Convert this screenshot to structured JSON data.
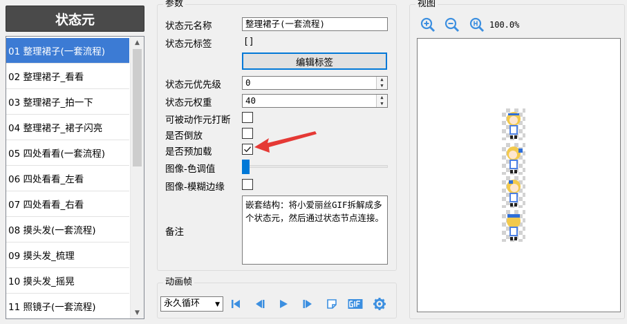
{
  "left_panel": {
    "title": "状态元",
    "items": [
      {
        "label": "01 整理裙子(一套流程)",
        "selected": true
      },
      {
        "label": "02 整理裙子_看看"
      },
      {
        "label": "03 整理裙子_拍一下"
      },
      {
        "label": "04 整理裙子_裙子闪亮"
      },
      {
        "label": "05 四处看看(一套流程)"
      },
      {
        "label": "06 四处看看_左看"
      },
      {
        "label": "07 四处看看_右看"
      },
      {
        "label": "08 摸头发(一套流程)"
      },
      {
        "label": "09 摸头发_梳理"
      },
      {
        "label": "10 摸头发_摇晃"
      },
      {
        "label": "11 照镜子(一套流程)"
      }
    ]
  },
  "params": {
    "group_title": "参数",
    "name_label": "状态元名称",
    "name_value": "整理裙子(一套流程)",
    "tag_label": "状态元标签",
    "tag_value": "[]",
    "edit_tag_button": "编辑标签",
    "priority_label": "状态元优先级",
    "priority_value": "0",
    "weight_label": "状态元权重",
    "weight_value": "40",
    "interruptible_label": "可被动作元打断",
    "interruptible_checked": false,
    "reverse_label": "是否倒放",
    "reverse_checked": false,
    "preload_label": "是否预加载",
    "preload_checked": true,
    "hue_label": "图像-色调值",
    "hue_value": 0,
    "blur_label": "图像-模糊边缘",
    "blur_checked": false,
    "note_label": "备注",
    "note_value": "嵌套结构：将小爱丽丝GIF拆解成多个状态元，然后通过状态节点连接。"
  },
  "animation": {
    "group_title": "动画帧",
    "loop_select": "永久循环"
  },
  "view": {
    "group_title": "视图",
    "zoom_text": "100.0%"
  },
  "colors": {
    "accent": "#0078d7",
    "selection": "#3c7bd4",
    "header_bg": "#4a4a4a",
    "arrow": "#e53935"
  }
}
